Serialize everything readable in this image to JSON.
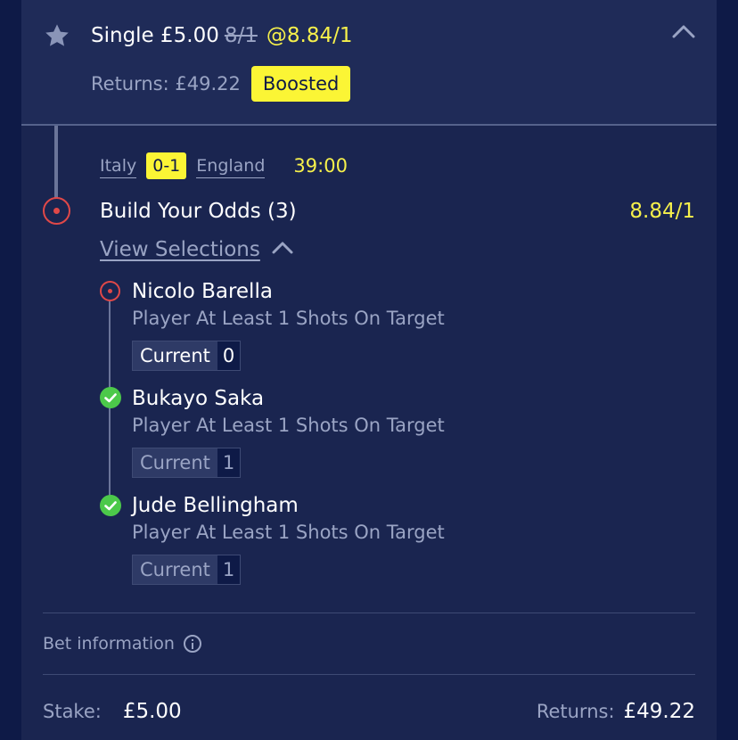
{
  "bet": {
    "type_stake": "Single £5.00",
    "original_odds": "8/1",
    "boosted_odds": "@8.84/1",
    "returns_label": "Returns: £49.22",
    "badge": "Boosted"
  },
  "match": {
    "home_team": "Italy",
    "score": "0-1",
    "away_team": "England",
    "time": "39:00"
  },
  "build": {
    "title": "Build Your Odds (3)",
    "odds": "8.84/1",
    "view_selections": "View Selections"
  },
  "selections": [
    {
      "player": "Nicolo Barella",
      "market": "Player At Least 1 Shots On Target",
      "current_label": "Current",
      "current_value": "0",
      "status": "pending"
    },
    {
      "player": "Bukayo Saka",
      "market": "Player At Least 1 Shots On Target",
      "current_label": "Current",
      "current_value": "1",
      "status": "won"
    },
    {
      "player": "Jude Bellingham",
      "market": "Player At Least 1 Shots On Target",
      "current_label": "Current",
      "current_value": "1",
      "status": "won"
    }
  ],
  "footer": {
    "bet_information": "Bet information",
    "stake_label": "Stake:",
    "stake_value": "£5.00",
    "returns_label": "Returns:",
    "returns_value": "£49.22"
  },
  "icons": {
    "star": "star-icon",
    "collapse": "chevron-up-icon",
    "info": "info-icon",
    "pending": "pending-dot-icon",
    "won": "check-circle-icon"
  },
  "colors": {
    "background": "#0e1a47",
    "card": "#1a2550",
    "header": "#1f2b58",
    "accent_yellow": "#fbf535",
    "odds_yellow": "#f6f04b",
    "pending_red": "#e04848",
    "won_green": "#4cc94a",
    "muted_text": "#9aa4c4"
  }
}
